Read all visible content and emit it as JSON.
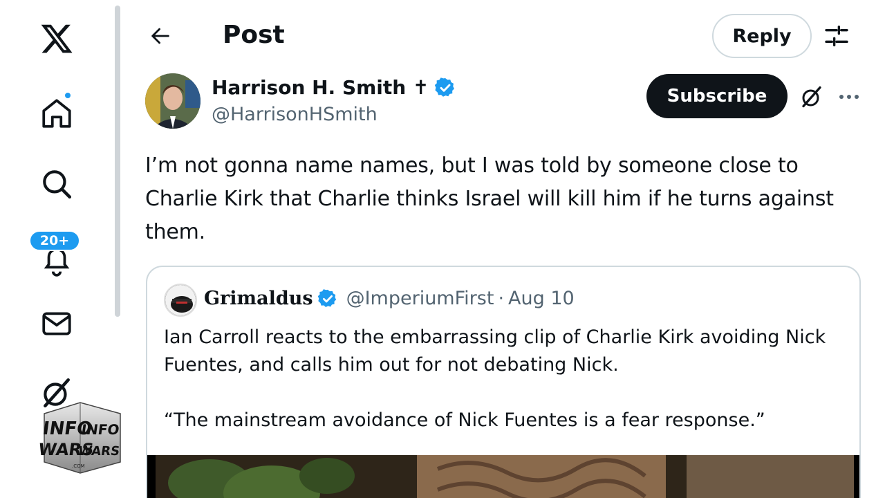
{
  "nav": {
    "items": [
      {
        "name": "x-logo",
        "icon": "x-logo"
      },
      {
        "name": "home",
        "icon": "home-icon",
        "has_dot": true
      },
      {
        "name": "explore",
        "icon": "search-icon"
      },
      {
        "name": "notifications",
        "icon": "bell-icon",
        "badge": "20+"
      },
      {
        "name": "messages",
        "icon": "mail-icon"
      },
      {
        "name": "grok",
        "icon": "grok-icon"
      }
    ],
    "overlay_logo": "INFOWARS"
  },
  "header": {
    "title": "Post",
    "reply_label": "Reply"
  },
  "post": {
    "author_name": "Harrison H. Smith ✝",
    "handle": "@HarrisonHSmith",
    "subscribe_label": "Subscribe",
    "text": "I’m not gonna name names, but I was told by someone close to Charlie Kirk that Charlie thinks Israel will kill him if he turns against them."
  },
  "quote": {
    "author_name": "Grimaldus",
    "handle": "@ImperiumFirst",
    "separator": "·",
    "date": "Aug 10",
    "text": "Ian Carroll reacts to the embarrassing clip of Charlie Kirk avoiding Nick Fuentes, and calls him out for not debating Nick.\n\n“The mainstream avoidance of Nick Fuentes is a fear response.”"
  },
  "colors": {
    "accent": "#1d9bf0",
    "text_primary": "#0f1419",
    "text_secondary": "#536471",
    "border": "#cfd9de"
  }
}
